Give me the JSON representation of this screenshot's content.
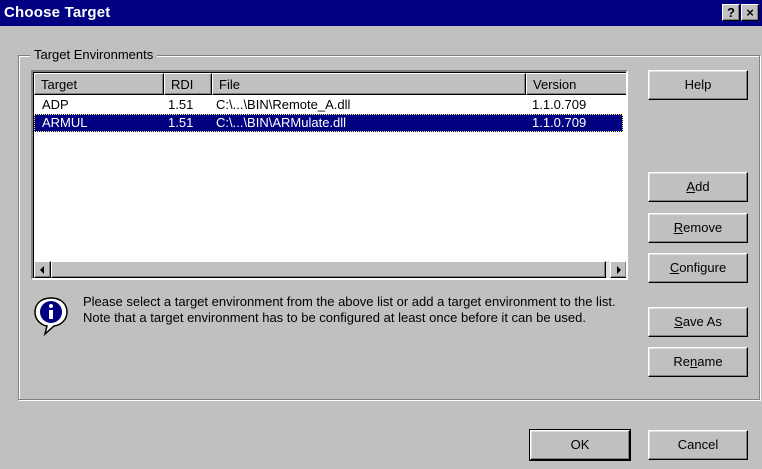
{
  "window": {
    "title": "Choose Target",
    "help_caption": "?",
    "close_caption": "×"
  },
  "group": {
    "label": "Target Environments"
  },
  "list": {
    "columns": [
      "Target",
      "RDI",
      "File",
      "Version"
    ],
    "rows": [
      {
        "target": "ADP",
        "rdi": "1.51",
        "file": "C:\\...\\BIN\\Remote_A.dll",
        "version": "1.1.0.709",
        "selected": false
      },
      {
        "target": "ARMUL",
        "rdi": "1.51",
        "file": "C:\\...\\BIN\\ARMulate.dll",
        "version": "1.1.0.709",
        "selected": true
      }
    ]
  },
  "info": {
    "icon": "info-icon",
    "text": "Please select a target environment from the above list or add a target environment to the list. Note that a target environment has to be configured at least once before it can be used."
  },
  "buttons": {
    "help": "Help",
    "add": {
      "mnemonic": "A",
      "rest": "dd"
    },
    "remove": {
      "mnemonic": "R",
      "rest": "emove"
    },
    "configure": {
      "mnemonic": "C",
      "rest": "onfigure"
    },
    "saveas": {
      "mnemonic": "S",
      "rest": "ave As"
    },
    "rename": {
      "pre": "Re",
      "mnemonic": "n",
      "rest": "ame"
    },
    "ok": "OK",
    "cancel": "Cancel"
  },
  "colors": {
    "face": "#c0c0c0",
    "titlebar": "#000080",
    "selection": "#000080"
  }
}
